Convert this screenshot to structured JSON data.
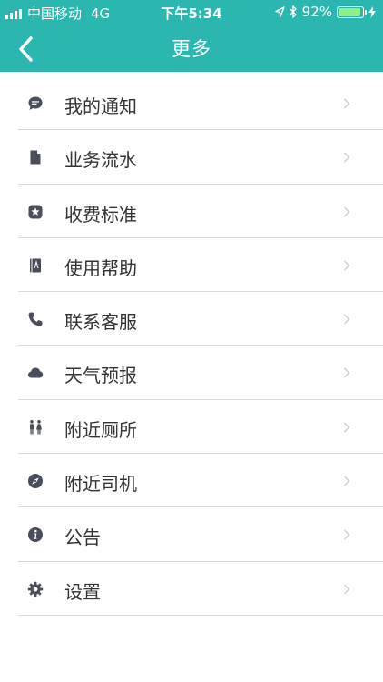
{
  "status_bar": {
    "carrier": "中国移动",
    "network": "4G",
    "time": "下午5:34",
    "battery": "92%",
    "battery_level": 0.92
  },
  "nav": {
    "back_icon": "chevron-left-icon",
    "title": "更多"
  },
  "menu": {
    "items": [
      {
        "label": "我的通知",
        "icon": "message-bubble-icon"
      },
      {
        "label": "业务流水",
        "icon": "document-icon"
      },
      {
        "label": "收费标准",
        "icon": "star-badge-icon"
      },
      {
        "label": "使用帮助",
        "icon": "help-book-icon"
      },
      {
        "label": "联系客服",
        "icon": "phone-icon"
      },
      {
        "label": "天气预报",
        "icon": "cloud-icon"
      },
      {
        "label": "附近厕所",
        "icon": "restroom-icon"
      },
      {
        "label": "附近司机",
        "icon": "compass-icon"
      },
      {
        "label": "公告",
        "icon": "info-icon"
      },
      {
        "label": "设置",
        "icon": "gear-icon"
      }
    ]
  },
  "colors": {
    "header": "#2bb7b0",
    "icon": "#4a4e5a",
    "text": "#333333",
    "divider": "#d9d9d9",
    "chevron": "#cccccc"
  }
}
